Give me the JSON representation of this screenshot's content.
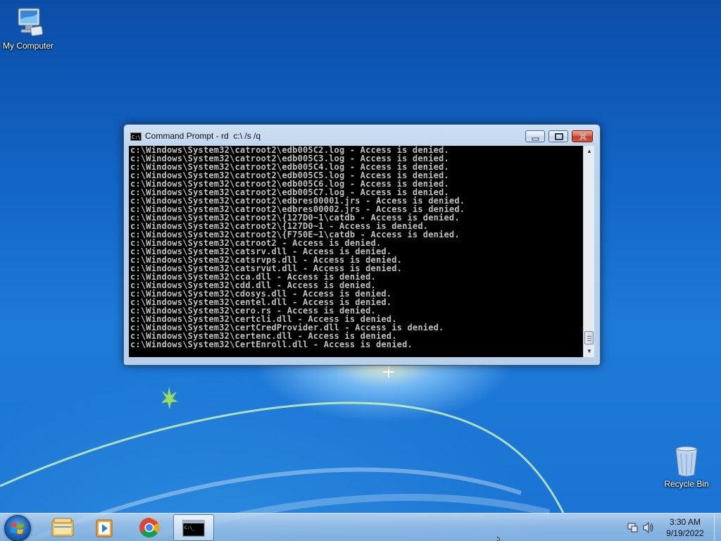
{
  "desktop": {
    "my_computer_label": "My Computer",
    "recycle_bin_label": "Recycle Bin"
  },
  "window": {
    "title": "Command Prompt - rd  c:\\ /s /q",
    "console_lines": [
      "c:\\Windows\\System32\\catroot2\\edb005C2.log - Access is denied.",
      "c:\\Windows\\System32\\catroot2\\edb005C3.log - Access is denied.",
      "c:\\Windows\\System32\\catroot2\\edb005C4.log - Access is denied.",
      "c:\\Windows\\System32\\catroot2\\edb005C5.log - Access is denied.",
      "c:\\Windows\\System32\\catroot2\\edb005C6.log - Access is denied.",
      "c:\\Windows\\System32\\catroot2\\edb005C7.log - Access is denied.",
      "c:\\Windows\\System32\\catroot2\\edbres00001.jrs - Access is denied.",
      "c:\\Windows\\System32\\catroot2\\edbres00002.jrs - Access is denied.",
      "c:\\Windows\\System32\\catroot2\\{127D0~1\\catdb - Access is denied.",
      "c:\\Windows\\System32\\catroot2\\{127D0~1 - Access is denied.",
      "c:\\Windows\\System32\\catroot2\\{F750E~1\\catdb - Access is denied.",
      "c:\\Windows\\System32\\catroot2 - Access is denied.",
      "c:\\Windows\\System32\\catsrv.dll - Access is denied.",
      "c:\\Windows\\System32\\catsrvps.dll - Access is denied.",
      "c:\\Windows\\System32\\catsrvut.dll - Access is denied.",
      "c:\\Windows\\System32\\cca.dll - Access is denied.",
      "c:\\Windows\\System32\\cdd.dll - Access is denied.",
      "c:\\Windows\\System32\\cdosys.dll - Access is denied.",
      "c:\\Windows\\System32\\centel.dll - Access is denied.",
      "c:\\Windows\\System32\\cero.rs - Access is denied.",
      "c:\\Windows\\System32\\certcli.dll - Access is denied.",
      "c:\\Windows\\System32\\certCredProvider.dll - Access is denied.",
      "c:\\Windows\\System32\\certenc.dll - Access is denied.",
      "c:\\Windows\\System32\\CertEnroll.dll - Access is denied."
    ]
  },
  "taskbar": {
    "items": [
      {
        "name": "windows-explorer-icon"
      },
      {
        "name": "media-player-icon"
      },
      {
        "name": "chrome-icon"
      },
      {
        "name": "command-prompt-icon",
        "active": true
      }
    ],
    "clock_time": "3:30 AM",
    "clock_date": "9/19/2022"
  },
  "colors": {
    "console_bg": "#000000",
    "console_fg": "#c0c0c0",
    "desktop_blue": "#1366c8"
  }
}
